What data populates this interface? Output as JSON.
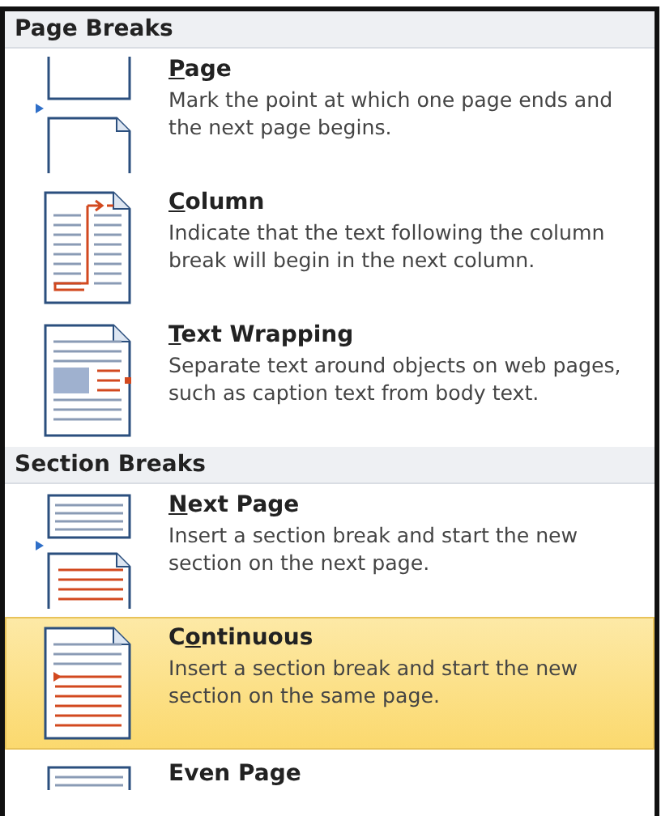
{
  "sections": [
    {
      "heading": "Page Breaks",
      "items": [
        {
          "kind": "page",
          "title": {
            "key": "P",
            "after": "age"
          },
          "description": "Mark the point at which one page ends and the next page begins.",
          "selected": false
        },
        {
          "kind": "column",
          "title": {
            "key": "C",
            "after": "olumn"
          },
          "description": "Indicate that the text following the column break will begin in the next column.",
          "selected": false
        },
        {
          "kind": "wrapping",
          "title": {
            "key": "T",
            "after": "ext Wrapping"
          },
          "description": "Separate text around objects on web pages, such as caption text from body text.",
          "selected": false
        }
      ]
    },
    {
      "heading": "Section Breaks",
      "items": [
        {
          "kind": "next",
          "title": {
            "key": "N",
            "after": "ext Page"
          },
          "description": "Insert a section break and start the new section on the next page.",
          "selected": false
        },
        {
          "kind": "continuous",
          "title": {
            "before": "C",
            "key": "o",
            "after": "ntinuous"
          },
          "description": "Insert a section break and start the new section on the same page.",
          "selected": true
        },
        {
          "kind": "even",
          "title": {
            "before": "Even Page"
          },
          "selected": false
        }
      ]
    }
  ]
}
